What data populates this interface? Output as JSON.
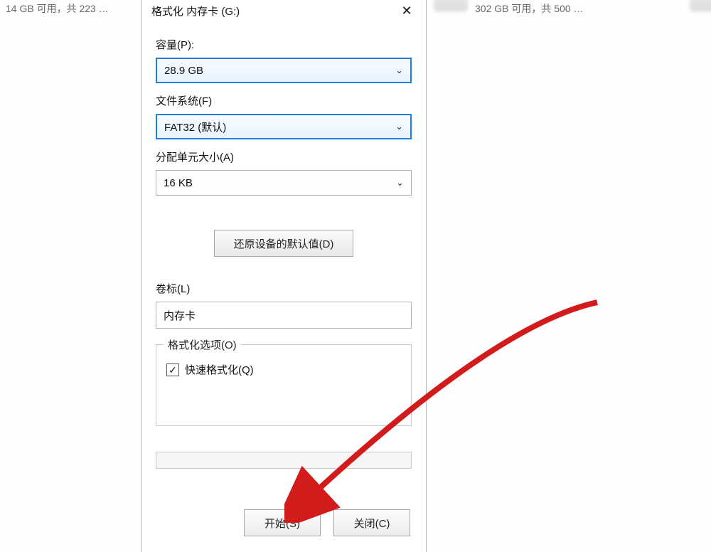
{
  "background": {
    "drive_left_text": "14 GB 可用，共 223 …",
    "drive_right_text": "302 GB 可用，共 500 …"
  },
  "dialog": {
    "title": "格式化 内存卡 (G:)",
    "capacity": {
      "label": "容量(P):",
      "value": "28.9 GB"
    },
    "filesystem": {
      "label": "文件系统(F)",
      "value": "FAT32 (默认)"
    },
    "allocation": {
      "label": "分配单元大小(A)",
      "value": "16 KB"
    },
    "restore_defaults_label": "还原设备的默认值(D)",
    "volume_label": {
      "label": "卷标(L)",
      "value": "内存卡"
    },
    "options": {
      "legend": "格式化选项(O)",
      "quick_format_label": "快速格式化(Q)",
      "quick_format_checked": true
    },
    "footer": {
      "start_label": "开始(S)",
      "close_label": "关闭(C)"
    }
  }
}
